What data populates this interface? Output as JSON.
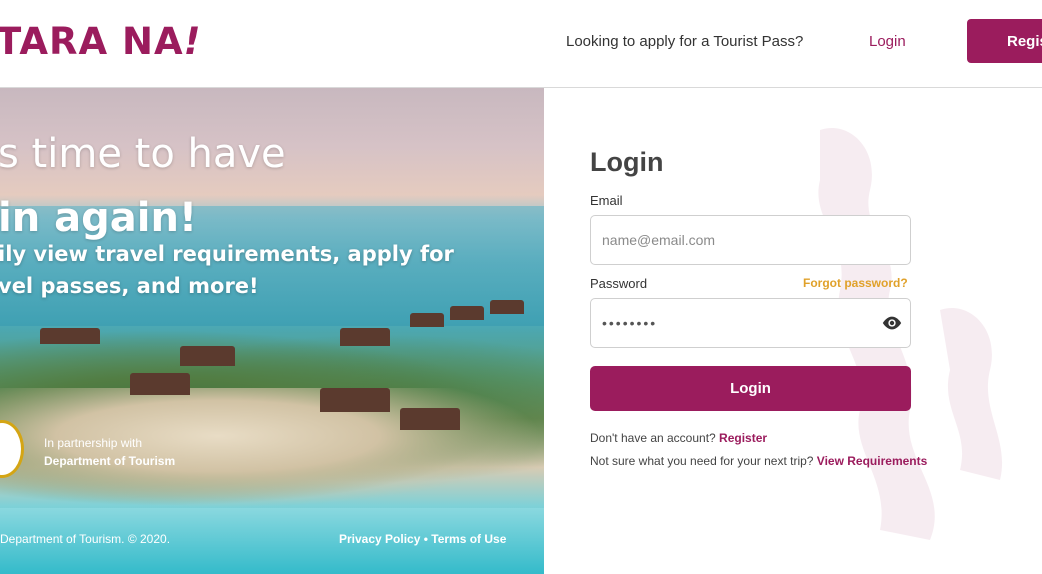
{
  "header": {
    "logo_text": "TARA NA",
    "logo_exclaim": "!",
    "tourist_pass_link": "Looking to apply for a Tourist Pass?",
    "login_link": "Login",
    "register_button": "Regis"
  },
  "hero": {
    "headline_line1": "s time to have",
    "headline_line2": "in again!",
    "sub_line1": "ily view travel requirements, apply for",
    "sub_line2": "vel passes, and more!",
    "partner_label": "In partnership with",
    "partner_name": "Department of Tourism",
    "copyright": "Department of Tourism. © 2020.",
    "privacy_policy": "Privacy Policy",
    "separator": " • ",
    "terms_of_use": "Terms of Use"
  },
  "login": {
    "title": "Login",
    "email_label": "Email",
    "email_placeholder": "name@email.com",
    "password_label": "Password",
    "forgot_password": "Forgot password?",
    "password_value": "••••••••",
    "submit_label": "Login",
    "no_account_text": "Don't have an account? ",
    "register_link": "Register",
    "not_sure_text": "Not sure what you need for your next trip? ",
    "view_requirements_link": "View Requirements"
  },
  "colors": {
    "brand": "#9b1c5d",
    "accent": "#e0a12a"
  },
  "icons": {
    "password_toggle": "eye-icon"
  }
}
